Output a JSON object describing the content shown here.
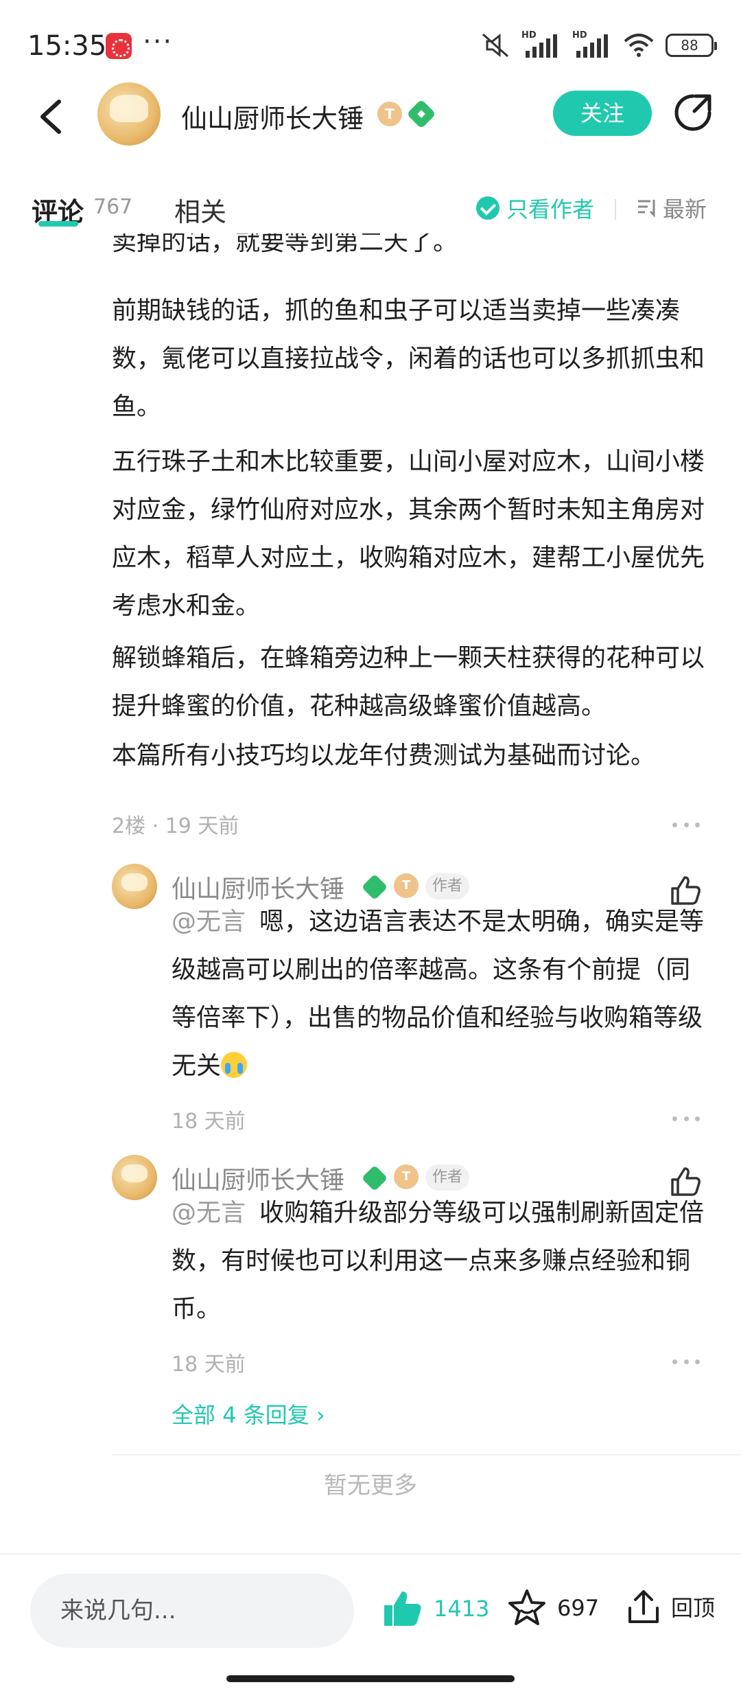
{
  "status_bar": {
    "time": "15:35",
    "dots": "···",
    "signal1_label": "HD",
    "signal2_label": "HD",
    "battery": "88"
  },
  "header": {
    "author_name": "仙山厨师长大锤",
    "badge_t": "T",
    "follow_label": "关注"
  },
  "tabs": {
    "comments_label": "评论",
    "comments_count": "767",
    "related_label": "相关",
    "author_only_label": "只看作者",
    "sort_label": "最新"
  },
  "article": {
    "paragraphs": [
      "卖掉的话，就要等到第二天了。",
      "前期缺钱的话，抓的鱼和虫子可以适当卖掉一些凑凑数，氪佬可以直接拉战令，闲着的话也可以多抓抓虫和鱼。",
      "五行珠子土和木比较重要，山间小屋对应木，山间小楼对应金，绿竹仙府对应水，其余两个暂时未知主角房对应木，稻草人对应土，收购箱对应木，建帮工小屋优先考虑水和金。",
      "解锁蜂箱后，在蜂箱旁边种上一颗天柱获得的花种可以提升蜂蜜的价值，花种越高级蜂蜜价值越高。",
      "本篇所有小技巧均以龙年付费测试为基础而讨论。"
    ]
  },
  "floor": {
    "meta": "2楼 · 19 天前"
  },
  "replies": [
    {
      "name": "仙山厨师长大锤",
      "badge_t": "T",
      "author_tag": "作者",
      "mention": "@无言",
      "text": "嗯，这边语言表达不是太明确，确实是等级越高可以刷出的倍率越高。这条有个前提（同等倍率下），出售的物品价值和经验与收购箱等级无关",
      "emoji": "crying-emoji",
      "time": "18 天前"
    },
    {
      "name": "仙山厨师长大锤",
      "badge_t": "T",
      "author_tag": "作者",
      "mention": "@无言",
      "text": "收购箱升级部分等级可以强制刷新固定倍数，有时候也可以利用这一点来多赚点经验和铜币。",
      "time": "18 天前"
    }
  ],
  "all_replies_label": "全部 4 条回复 ›",
  "no_more_label": "暂无更多",
  "bottom_bar": {
    "input_placeholder": "来说几句...",
    "like_count": "1413",
    "star_count": "697",
    "top_label": "回顶"
  },
  "colors": {
    "accent": "#20c9ad",
    "text": "#1f1f1f",
    "muted": "#b0b0b0",
    "badge_green": "#2fbd6c",
    "badge_gold": "#efc38a"
  }
}
